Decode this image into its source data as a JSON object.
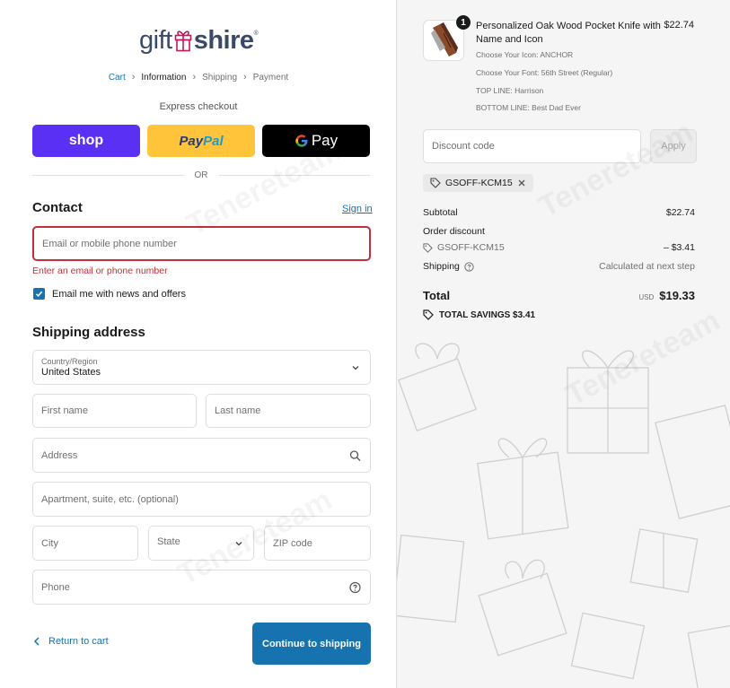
{
  "logo": {
    "part_a": "gift",
    "part_b": "shire",
    "reg": "®"
  },
  "breadcrumb": {
    "cart": "Cart",
    "information": "Information",
    "shipping": "Shipping",
    "payment": "Payment",
    "sep": "›"
  },
  "express": {
    "label": "Express checkout",
    "shop": "shop",
    "paypal_a": "Pay",
    "paypal_b": "Pal",
    "gpay_g": "G",
    "gpay": "Pay",
    "or": "OR"
  },
  "contact": {
    "heading": "Contact",
    "signin": "Sign in",
    "email_placeholder": "Email or mobile phone number",
    "error": "Enter an email or phone number",
    "newsletter_label": "Email me with news and offers",
    "newsletter_checked": true
  },
  "shipping": {
    "heading": "Shipping address",
    "country_label": "Country/Region",
    "country_value": "United States",
    "first_name": "First name",
    "last_name": "Last name",
    "address": "Address",
    "apartment": "Apartment, suite, etc. (optional)",
    "city": "City",
    "state": "State",
    "zip": "ZIP code",
    "phone": "Phone"
  },
  "footer": {
    "return": "Return to cart",
    "continue": "Continue to shipping"
  },
  "order": {
    "product": {
      "quantity": "1",
      "title": "Personalized Oak Wood Pocket Knife with Name and Icon",
      "price": "$22.74",
      "props": [
        "Choose Your Icon: ANCHOR",
        "Choose Your Font: 56th Street (Regular)",
        "TOP LINE: Harrison",
        "BOTTOM LINE: Best Dad Ever"
      ]
    },
    "discount_placeholder": "Discount code",
    "apply": "Apply",
    "applied_code": "GSOFF-KCM15",
    "subtotal_label": "Subtotal",
    "subtotal_value": "$22.74",
    "order_discount_label": "Order discount",
    "discount_code": "GSOFF-KCM15",
    "discount_value": "– $3.41",
    "shipping_label": "Shipping",
    "shipping_value": "Calculated at next step",
    "total_label": "Total",
    "currency": "USD",
    "total_value": "$19.33",
    "savings": "TOTAL SAVINGS  $3.41"
  },
  "watermark": "Tenereteam",
  "colors": {
    "accent": "#1773b0",
    "error": "#c1303a",
    "shop": "#5a31f4",
    "paypal": "#ffc439",
    "gpay": "#000000"
  }
}
